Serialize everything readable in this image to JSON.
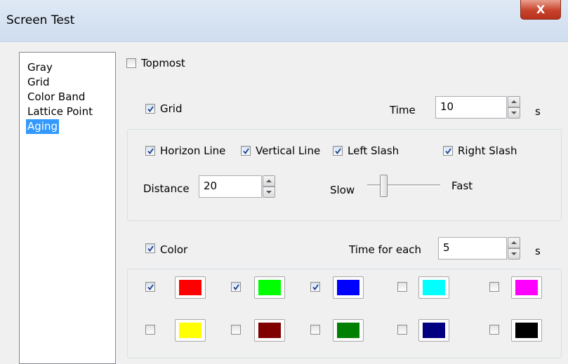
{
  "window": {
    "title": "Screen Test",
    "close_glyph": "X"
  },
  "sidebar": {
    "items": [
      {
        "label": "Gray"
      },
      {
        "label": "Grid"
      },
      {
        "label": "Color Band"
      },
      {
        "label": "Lattice Point"
      },
      {
        "label": "Aging",
        "selected": true
      }
    ]
  },
  "topmost": {
    "label": "Topmost",
    "checked": false
  },
  "grid": {
    "label": "Grid",
    "checked": true,
    "time_label": "Time",
    "time_value": "10",
    "time_unit": "s",
    "options": {
      "horizon_line": {
        "label": "Horizon Line",
        "checked": true
      },
      "vertical_line": {
        "label": "Vertical Line",
        "checked": true
      },
      "left_slash": {
        "label": "Left Slash",
        "checked": true
      },
      "right_slash": {
        "label": "Right Slash",
        "checked": true
      }
    },
    "distance_label": "Distance",
    "distance_value": "20",
    "speed": {
      "slow_label": "Slow",
      "fast_label": "Fast"
    }
  },
  "color": {
    "label": "Color",
    "checked": true,
    "time_label": "Time for each",
    "time_value": "5",
    "time_unit": "s",
    "swatches": [
      {
        "color": "#ff0000",
        "checked": true
      },
      {
        "color": "#00ff00",
        "checked": true
      },
      {
        "color": "#0000ff",
        "checked": true
      },
      {
        "color": "#00ffff",
        "checked": false
      },
      {
        "color": "#ff00ff",
        "checked": false
      },
      {
        "color": "#ffff00",
        "checked": false
      },
      {
        "color": "#800000",
        "checked": false
      },
      {
        "color": "#008000",
        "checked": false
      },
      {
        "color": "#000080",
        "checked": false
      },
      {
        "color": "#000000",
        "checked": false
      }
    ]
  }
}
